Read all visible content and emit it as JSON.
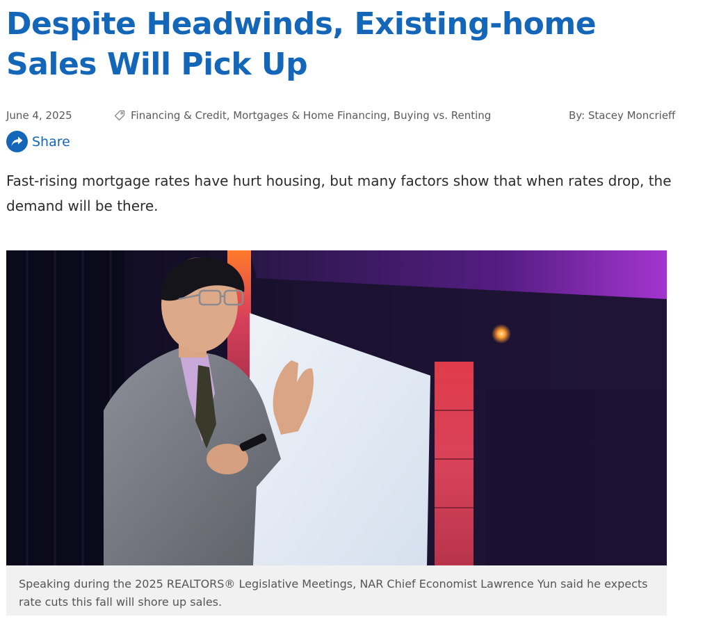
{
  "article": {
    "headline": "Despite Headwinds, Existing-home Sales Will Pick Up",
    "date": "June 4, 2025",
    "tags": "Financing & Credit, Mortgages & Home Financing, Buying vs. Renting",
    "author": "By: Stacey Moncrieff",
    "share_label": "Share",
    "dek": "Fast-rising mortgage rates have hurt housing, but many factors show that when rates drop, the demand will be there.",
    "caption": "Speaking during the 2025 REALTORS® Legislative Meetings, NAR Chief Economist Lawrence Yun said he expects rate cuts this fall will shore up sales."
  },
  "colors": {
    "brand_blue": "#1467b8",
    "text": "#2b2b2b",
    "meta": "#5a5a5a",
    "caption_bg": "#f1f1f1"
  },
  "icons": {
    "tag": "tag-icon",
    "share": "share-arrow-icon"
  }
}
